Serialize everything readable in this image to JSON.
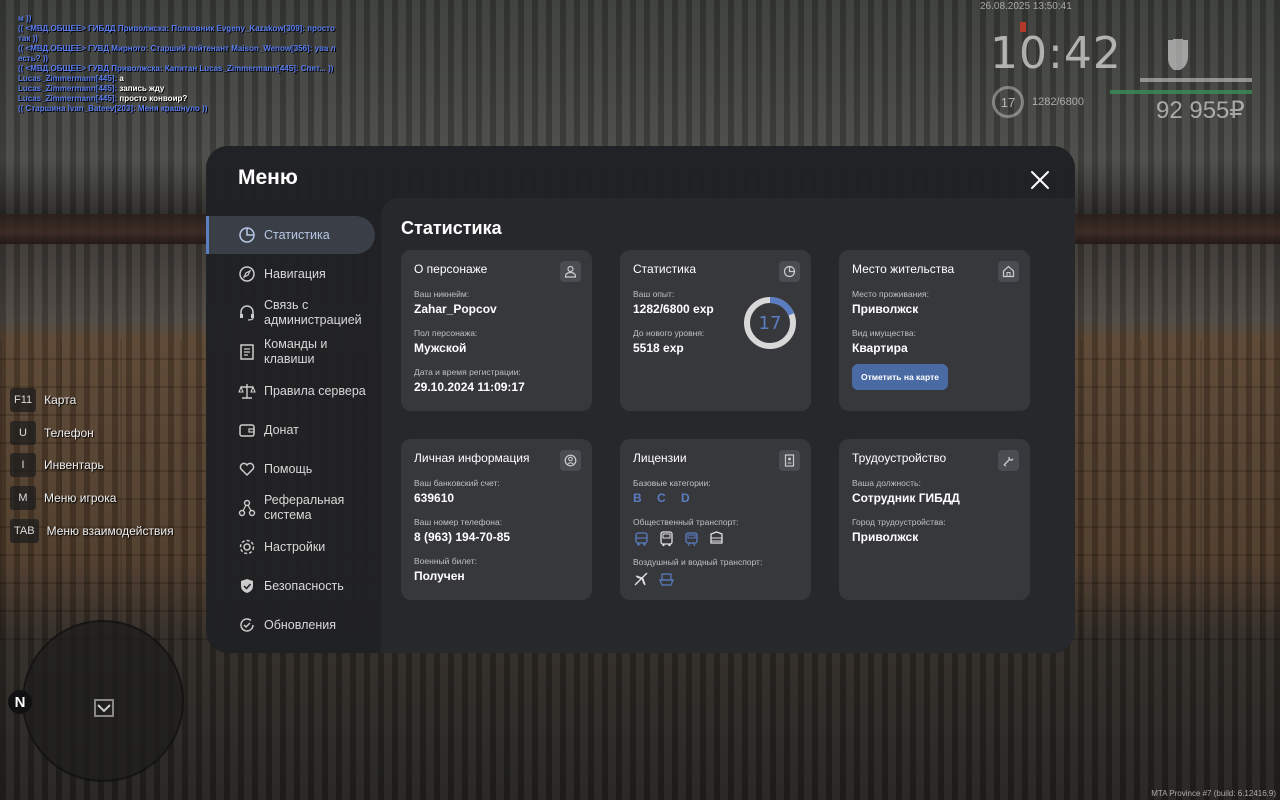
{
  "chat": [
    {
      "text": "м ))",
      "color": "blue"
    },
    {
      "text": "(( <МВД.ОБЩЕЕ> ГИБДД Приволжска: Полковник Evgeny_Kazakow[309]: просто так ))",
      "color": "blue"
    },
    {
      "text": "(( <МВД.ОБЩЕЕ> ГУВД Мирного: Старший лейтенант Maison_Wenow[356]: ува л есть? ))",
      "color": "blue"
    },
    {
      "text": "(( <МВД.ОБЩЕЕ> ГУВД Приволжска: Капитан Lucas_Zimmermann[445]: Спят... ))",
      "color": "blue"
    },
    {
      "name": "Lucas_Zimmermann[445]:",
      "text": " а",
      "color": "mixed"
    },
    {
      "name": "Lucas_Zimmermann[445]:",
      "text": " запись жду",
      "color": "mixed"
    },
    {
      "name": "Lucas_Zimmermann[445]:",
      "text": " просто конвоир?",
      "color": "mixed"
    },
    {
      "text": "(( Старшина Ivan_Bateev[203]: Меня крашнуло ))",
      "color": "blue"
    }
  ],
  "hud": {
    "datetime": "26.08.2025 13:50:41",
    "clock": "10:42",
    "level": "17",
    "exp": "1282/6800",
    "money": "92 955₽"
  },
  "keybinds": [
    {
      "key": "F11",
      "label": "Карта"
    },
    {
      "key": "U",
      "label": "Телефон"
    },
    {
      "key": "I",
      "label": "Инвентарь"
    },
    {
      "key": "M",
      "label": "Меню игрока"
    },
    {
      "key": "TAB",
      "label": "Меню взаимодействия"
    }
  ],
  "radar": {
    "north": "N"
  },
  "build": "MTA Province #7 (build: 6.12416.9)",
  "menu": {
    "title": "Меню",
    "nav": [
      {
        "label": "Статистика",
        "icon": "pie-chart-icon",
        "active": true
      },
      {
        "label": "Навигация",
        "icon": "compass-icon"
      },
      {
        "label": "Связь с администрацией",
        "icon": "headset-icon"
      },
      {
        "label": "Команды и клавиши",
        "icon": "document-icon"
      },
      {
        "label": "Правила сервера",
        "icon": "scales-icon"
      },
      {
        "label": "Донат",
        "icon": "wallet-icon"
      },
      {
        "label": "Помощь",
        "icon": "heart-hand-icon"
      },
      {
        "label": "Реферальная система",
        "icon": "referral-icon"
      },
      {
        "label": "Настройки",
        "icon": "gear-icon"
      },
      {
        "label": "Безопасность",
        "icon": "shield-icon"
      },
      {
        "label": "Обновления",
        "icon": "refresh-check-icon"
      }
    ],
    "content_title": "Статистика",
    "cards": {
      "character": {
        "title": "О персонаже",
        "nick_label": "Ваш никнейм:",
        "nick": "Zahar_Popcov",
        "gender_label": "Пол персонажа:",
        "gender": "Мужской",
        "reg_label": "Дата и время регистрации:",
        "reg": "29.10.2024 11:09:17"
      },
      "stats": {
        "title": "Статистика",
        "exp_label": "Ваш опыт:",
        "exp": "1282/6800 exp",
        "next_label": "До нового уровня:",
        "next": "5518 exp",
        "level": "17",
        "progress": 0.1885
      },
      "residence": {
        "title": "Место жительства",
        "place_label": "Место проживания:",
        "place": "Приволжск",
        "type_label": "Вид имущества:",
        "type": "Квартира",
        "button": "Отметить на карте"
      },
      "personal": {
        "title": "Личная информация",
        "bank_label": "Ваш банковский счет:",
        "bank": "639610",
        "phone_label": "Ваш номер телефона:",
        "phone": "8 (963) 194-70-85",
        "military_label": "Военный билет:",
        "military": "Получен"
      },
      "licenses": {
        "title": "Лицензии",
        "base_label": "Базовые категории:",
        "base": "B C D",
        "public_label": "Общественный транспорт:",
        "public_icons": [
          "bus-icon",
          "coach-icon",
          "tram-icon",
          "trolley-icon"
        ],
        "air_label": "Воздушный и водный транспорт:",
        "air_icons": [
          "plane-icon",
          "boat-icon"
        ]
      },
      "job": {
        "title": "Трудоустройство",
        "position_label": "Ваша должность:",
        "position": "Сотрудник ГИБДД",
        "city_label": "Город трудоустройства:",
        "city": "Приволжск"
      }
    }
  },
  "colors": {
    "accent": "#5b7fc0",
    "button": "#4a6aa4",
    "card": "#37383c",
    "panel": "#27282c"
  }
}
